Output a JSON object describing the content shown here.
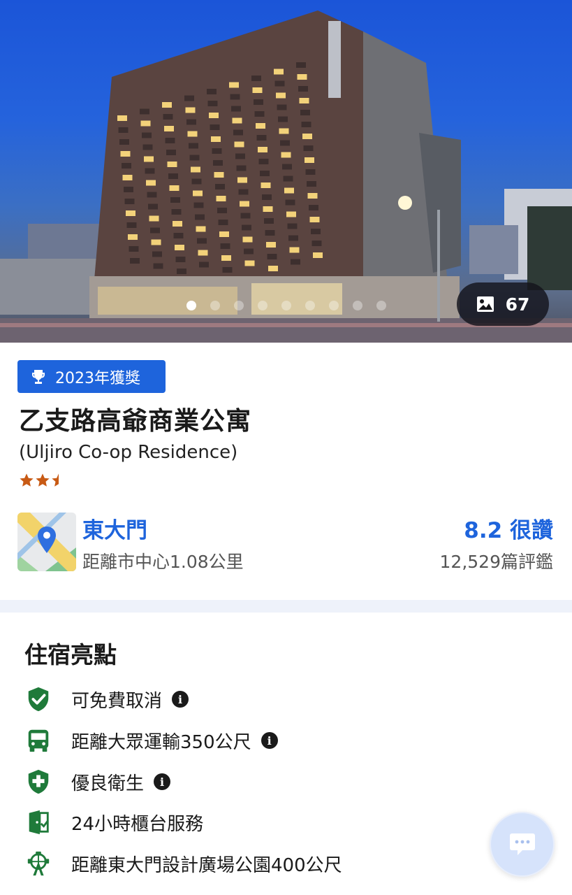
{
  "hero": {
    "photo_count": "67",
    "carousel_dots": 9,
    "active_dot": 0
  },
  "award": {
    "label": "2023年獲獎",
    "icon": "trophy-icon"
  },
  "hotel": {
    "name": "乙支路高爺商業公寓",
    "name_en": "(Uljiro Co-op Residence)",
    "star_rating": 2.5
  },
  "location": {
    "area": "東大門",
    "distance": "距離市中心1.08公里"
  },
  "rating": {
    "score_text": "8.2 很讚",
    "reviews": "12,529篇評鑑"
  },
  "highlights": {
    "title": "住宿亮點",
    "items": [
      {
        "icon": "shield-check-icon",
        "label": "可免費取消",
        "info": true
      },
      {
        "icon": "bus-icon",
        "label": "距離大眾運輸350公尺",
        "info": true
      },
      {
        "icon": "health-shield-icon",
        "label": "優良衛生",
        "info": true
      },
      {
        "icon": "reception-door-icon",
        "label": "24小時櫃台服務",
        "info": false
      },
      {
        "icon": "ferris-wheel-icon",
        "label": "距離東大門設計廣場公園400公尺",
        "info": false
      }
    ]
  },
  "colors": {
    "accent": "#1e64dc",
    "icon_green": "#1f7a3a",
    "star": "#c85a14",
    "divider": "#eef2fa"
  }
}
